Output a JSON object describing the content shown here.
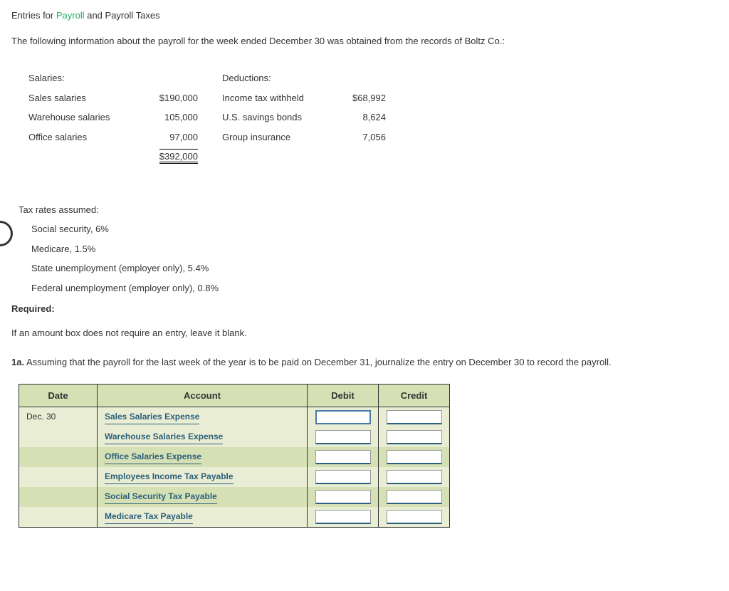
{
  "title": {
    "prefix": "Entries for ",
    "link": "Payroll",
    "suffix": " and Payroll Taxes"
  },
  "intro": "The following information about the payroll for the week ended December 30 was obtained from the records of Boltz Co.:",
  "salaries": {
    "header": "Salaries:",
    "rows": [
      {
        "label": "Sales salaries",
        "amount": "$190,000"
      },
      {
        "label": "Warehouse salaries",
        "amount": "105,000"
      },
      {
        "label": "Office salaries",
        "amount": "97,000"
      }
    ],
    "total": "$392,000"
  },
  "deductions": {
    "header": "Deductions:",
    "rows": [
      {
        "label": "Income tax withheld",
        "amount": "$68,992"
      },
      {
        "label": "U.S. savings bonds",
        "amount": "8,624"
      },
      {
        "label": "Group insurance",
        "amount": "7,056"
      }
    ]
  },
  "tax": {
    "header": "Tax rates assumed:",
    "items": [
      "Social security, 6%",
      "Medicare, 1.5%",
      "State unemployment (employer only), 5.4%",
      "Federal unemployment (employer only), 0.8%"
    ]
  },
  "required": "Required:",
  "instruction": "If an amount box does not require an entry, leave it blank.",
  "question": {
    "num": "1a.",
    "text": "  Assuming that the payroll for the last week of the year is to be paid on December 31, journalize the entry on December 30 to record the payroll."
  },
  "journal": {
    "headers": {
      "date": "Date",
      "account": "Account",
      "debit": "Debit",
      "credit": "Credit"
    },
    "date": "Dec. 30",
    "rows": [
      {
        "account": "Sales Salaries Expense"
      },
      {
        "account": "Warehouse Salaries Expense"
      },
      {
        "account": "Office Salaries Expense"
      },
      {
        "account": "Employees Income Tax Payable"
      },
      {
        "account": "Social Security Tax Payable"
      },
      {
        "account": "Medicare Tax Payable"
      }
    ]
  }
}
